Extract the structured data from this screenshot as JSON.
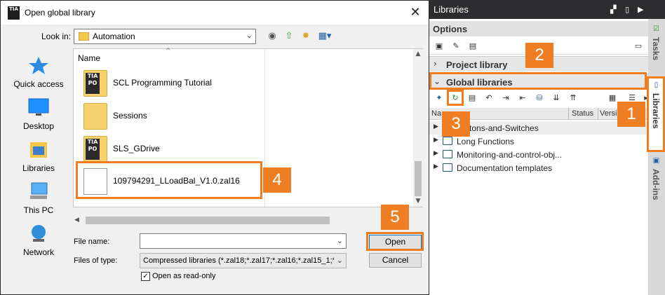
{
  "dialog": {
    "title": "Open global library",
    "title_icon_text": "TIA",
    "close_glyph": "✕",
    "look_in_label": "Look in:",
    "look_in_value": "Automation",
    "places": [
      {
        "label": "Quick access",
        "icon": "star-icon"
      },
      {
        "label": "Desktop",
        "icon": "desktop-icon"
      },
      {
        "label": "Libraries",
        "icon": "libraries-icon"
      },
      {
        "label": "This PC",
        "icon": "computer-icon"
      },
      {
        "label": "Network",
        "icon": "network-icon"
      }
    ],
    "column_name": "Name",
    "files": [
      {
        "name": "SCL Programming Tutorial",
        "type": "folder-tia"
      },
      {
        "name": "Sessions",
        "type": "folder"
      },
      {
        "name": "SLS_GDrive",
        "type": "folder-tia"
      },
      {
        "name": "109794291_LLoadBal_V1.0.zal16",
        "type": "file"
      }
    ],
    "file_name_label": "File name:",
    "file_name_value": "",
    "files_of_type_label": "Files of type:",
    "files_of_type_value": "Compressed libraries (*.zal18;*.zal17;*.zal16;*.zal15_1;*.za",
    "read_only_label": "Open as read-only",
    "read_only_checked": true,
    "open_button": "Open",
    "cancel_button": "Cancel"
  },
  "panel": {
    "title": "Libraries",
    "options_label": "Options",
    "project_library_label": "Project library",
    "global_libraries_label": "Global libraries",
    "columns": {
      "name": "Na",
      "status": "Status",
      "version": "Versi"
    },
    "libraries": [
      "Buttons-and-Switches",
      "Long Functions",
      "Monitoring-and-control-obj...",
      "Documentation templates"
    ]
  },
  "sidebar": {
    "tabs": [
      {
        "label": "Tasks"
      },
      {
        "label": "Libraries"
      },
      {
        "label": "Add-ins"
      }
    ]
  },
  "callouts": [
    "1",
    "2",
    "3",
    "4",
    "5"
  ],
  "colors": {
    "accent_orange": "#ef7d22",
    "dark_header": "#2d2d30",
    "focus_blue": "#0078d7"
  }
}
